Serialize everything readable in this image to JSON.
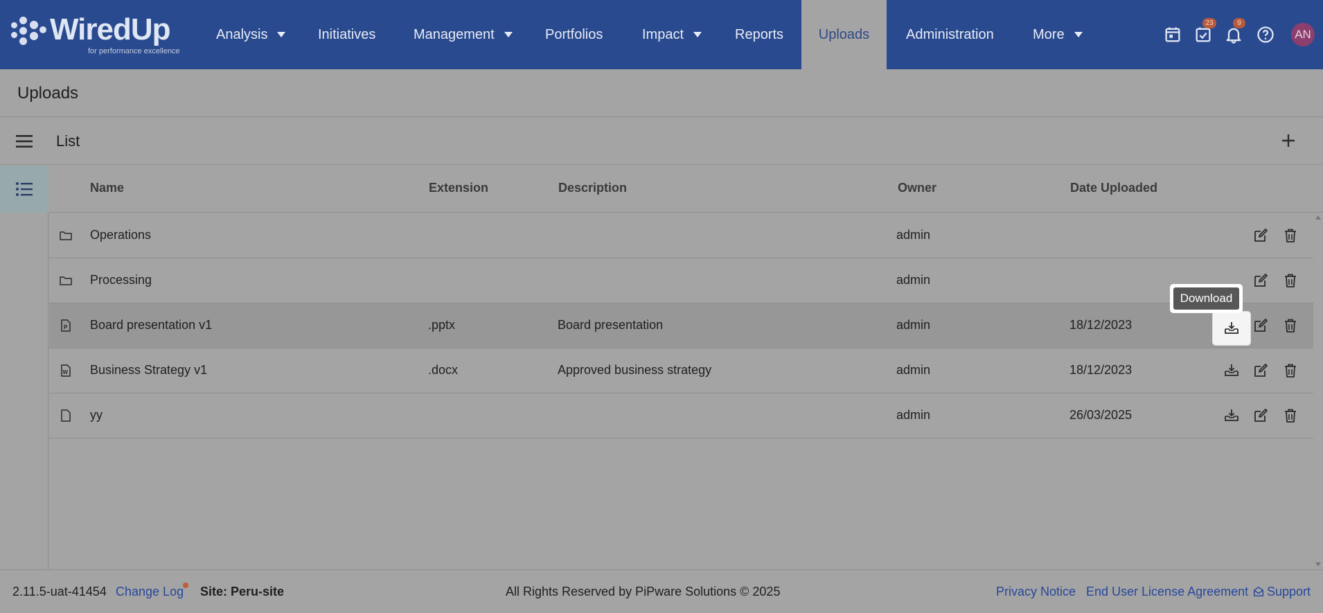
{
  "brand": {
    "name": "WiredUp",
    "tagline": "for performance excellence"
  },
  "nav": {
    "items": [
      {
        "label": "Analysis",
        "dropdown": true
      },
      {
        "label": "Initiatives",
        "dropdown": false
      },
      {
        "label": "Management",
        "dropdown": true
      },
      {
        "label": "Portfolios",
        "dropdown": false
      },
      {
        "label": "Impact",
        "dropdown": true
      },
      {
        "label": "Reports",
        "dropdown": false
      },
      {
        "label": "Uploads",
        "dropdown": false,
        "active": true
      },
      {
        "label": "Administration",
        "dropdown": false
      },
      {
        "label": "More",
        "dropdown": true
      }
    ],
    "tasks_badge": "23",
    "notifications_badge": "9",
    "avatar_initials": "AN"
  },
  "page": {
    "title": "Uploads"
  },
  "list": {
    "title": "List"
  },
  "table": {
    "columns": {
      "name": "Name",
      "extension": "Extension",
      "description": "Description",
      "owner": "Owner",
      "date": "Date Uploaded"
    },
    "rows": [
      {
        "icon": "folder-icon",
        "name": "Operations",
        "extension": "",
        "description": "",
        "owner": "admin",
        "date": ""
      },
      {
        "icon": "folder-icon",
        "name": "Processing",
        "extension": "",
        "description": "",
        "owner": "admin",
        "date": ""
      },
      {
        "icon": "powerpoint-file-icon",
        "name": "Board presentation v1",
        "extension": ".pptx",
        "description": "Board presentation",
        "owner": "admin",
        "date": "18/12/2023"
      },
      {
        "icon": "word-file-icon",
        "name": "Business Strategy v1",
        "extension": ".docx",
        "description": "Approved business strategy",
        "owner": "admin",
        "date": "18/12/2023"
      },
      {
        "icon": "file-icon",
        "name": "yy",
        "extension": "",
        "description": "",
        "owner": "admin",
        "date": "26/03/2025"
      }
    ]
  },
  "tooltip": {
    "text": "Download"
  },
  "footer": {
    "version": "2.11.5-uat-41454",
    "changelog": "Change Log",
    "site": "Site: Peru-site",
    "copyright": "All Rights Reserved by PiPware Solutions © 2025",
    "privacy": "Privacy Notice",
    "eula": "End User License Agreement",
    "support": "Support"
  },
  "colors": {
    "header": "#2a4a8f",
    "overlay": "#a4a4a4",
    "link": "#27479a"
  }
}
